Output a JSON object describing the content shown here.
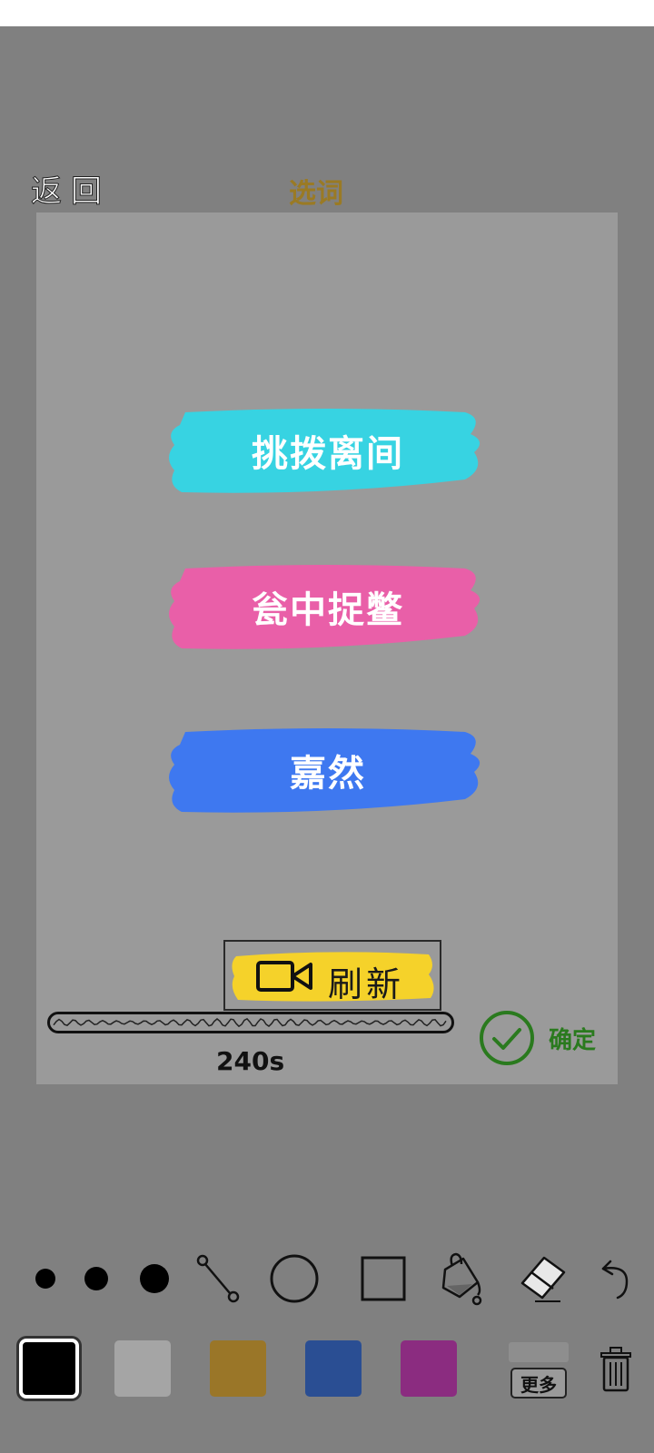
{
  "header": {
    "back_label": "返回",
    "title": "选词"
  },
  "words": [
    {
      "label": "挑拨离间",
      "color": "#37d3e2"
    },
    {
      "label": "瓮中捉鳖",
      "color": "#e95fa8"
    },
    {
      "label": "嘉然",
      "color": "#3e78f0"
    }
  ],
  "refresh": {
    "label": "刷新",
    "icon": "video-camera-icon",
    "highlight_color": "#f5d22a"
  },
  "timer": {
    "remaining": "240s"
  },
  "confirm": {
    "label": "确定",
    "icon": "check-circle-icon",
    "color": "#2a7a1e"
  },
  "toolbar": {
    "tools": [
      "small-dot-brush",
      "medium-dot-brush",
      "large-dot-brush",
      "line-tool",
      "circle-tool",
      "rectangle-tool",
      "fill-bucket",
      "eraser",
      "undo"
    ]
  },
  "palette": {
    "colors": [
      "#000000",
      "#a5a5a5",
      "#9a7628",
      "#2a4e93",
      "#8b2c80"
    ],
    "selected_index": 0,
    "more_label": "更多"
  }
}
